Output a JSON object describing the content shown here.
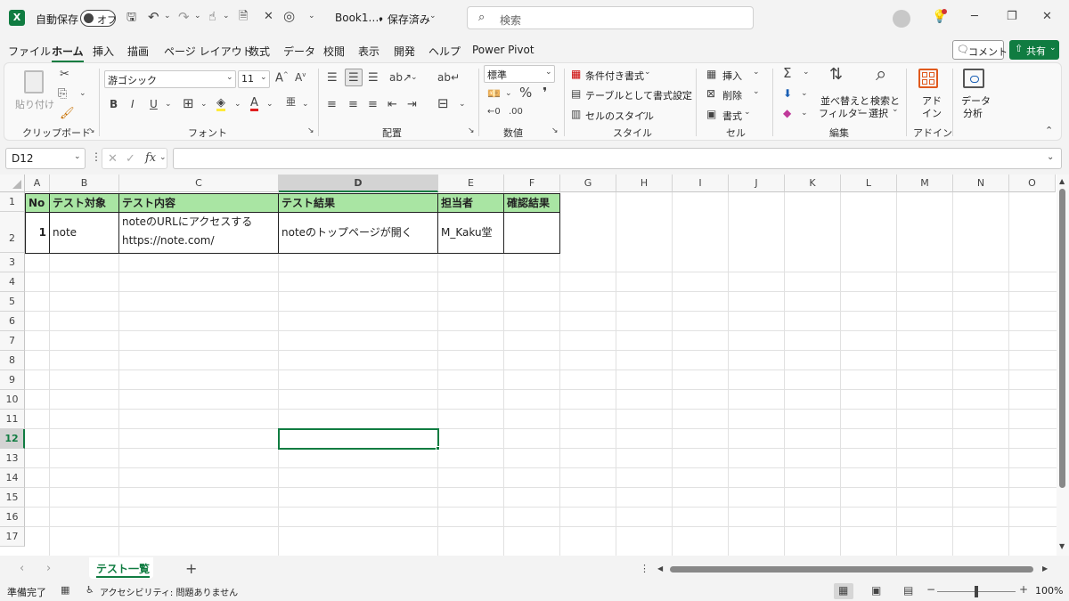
{
  "titlebar": {
    "autosave_label": "自動保存",
    "autosave_state": "オフ",
    "filename": "Book1.…",
    "save_status": "• 保存済み",
    "search_placeholder": "検索"
  },
  "menu": [
    "ファイル",
    "ホーム",
    "挿入",
    "描画",
    "ページ レイアウト",
    "数式",
    "データ",
    "校閲",
    "表示",
    "開発",
    "ヘルプ",
    "Power Pivot"
  ],
  "menu_right": {
    "comment": "コメント",
    "share": "共有"
  },
  "ribbon": {
    "clipboard": {
      "paste": "貼り付け",
      "label": "クリップボード"
    },
    "font": {
      "name": "游ゴシック",
      "size": "11",
      "label": "フォント",
      "bold": "B",
      "italic": "I",
      "underline": "U"
    },
    "alignment": {
      "label": "配置"
    },
    "number": {
      "format": "標準",
      "label": "数値"
    },
    "styles": {
      "conditional": "条件付き書式",
      "table": "テーブルとして書式設定",
      "cell": "セルのスタイル",
      "label": "スタイル"
    },
    "cells": {
      "insert": "挿入",
      "delete": "削除",
      "format": "書式",
      "label": "セル"
    },
    "editing": {
      "sort": "並べ替えと",
      "sort2": "フィルター",
      "find": "検索と",
      "find2": "選択",
      "label": "編集"
    },
    "addins": {
      "l1": "アド",
      "l2": "イン",
      "label": "アドイン"
    },
    "analysis": {
      "l1": "データ",
      "l2": "分析"
    }
  },
  "formula": {
    "namebox": "D12",
    "fx": "fx",
    "content": ""
  },
  "columns": [
    "A",
    "B",
    "C",
    "D",
    "E",
    "F",
    "G",
    "H",
    "I",
    "J",
    "K",
    "L",
    "M",
    "N",
    "O"
  ],
  "rows": [
    "1",
    "2",
    "3",
    "4",
    "5",
    "6",
    "7",
    "8",
    "9",
    "10",
    "11",
    "12",
    "13",
    "14",
    "15",
    "16",
    "17"
  ],
  "table": {
    "headers": [
      "No",
      "テスト対象",
      "テスト内容",
      "テスト結果",
      "担当者",
      "確認結果"
    ],
    "row": {
      "no": "1",
      "target": "note",
      "content_line1": "noteのURLにアクセスする",
      "content_line2": "https://note.com/",
      "result": "noteのトップページが開く",
      "owner": "M_Kaku堂",
      "check": ""
    }
  },
  "sheets": {
    "active": "テスト一覧",
    "add": "+"
  },
  "status": {
    "ready": "準備完了",
    "accessibility": "アクセシビリティ: 問題ありません",
    "zoom": "100%"
  }
}
